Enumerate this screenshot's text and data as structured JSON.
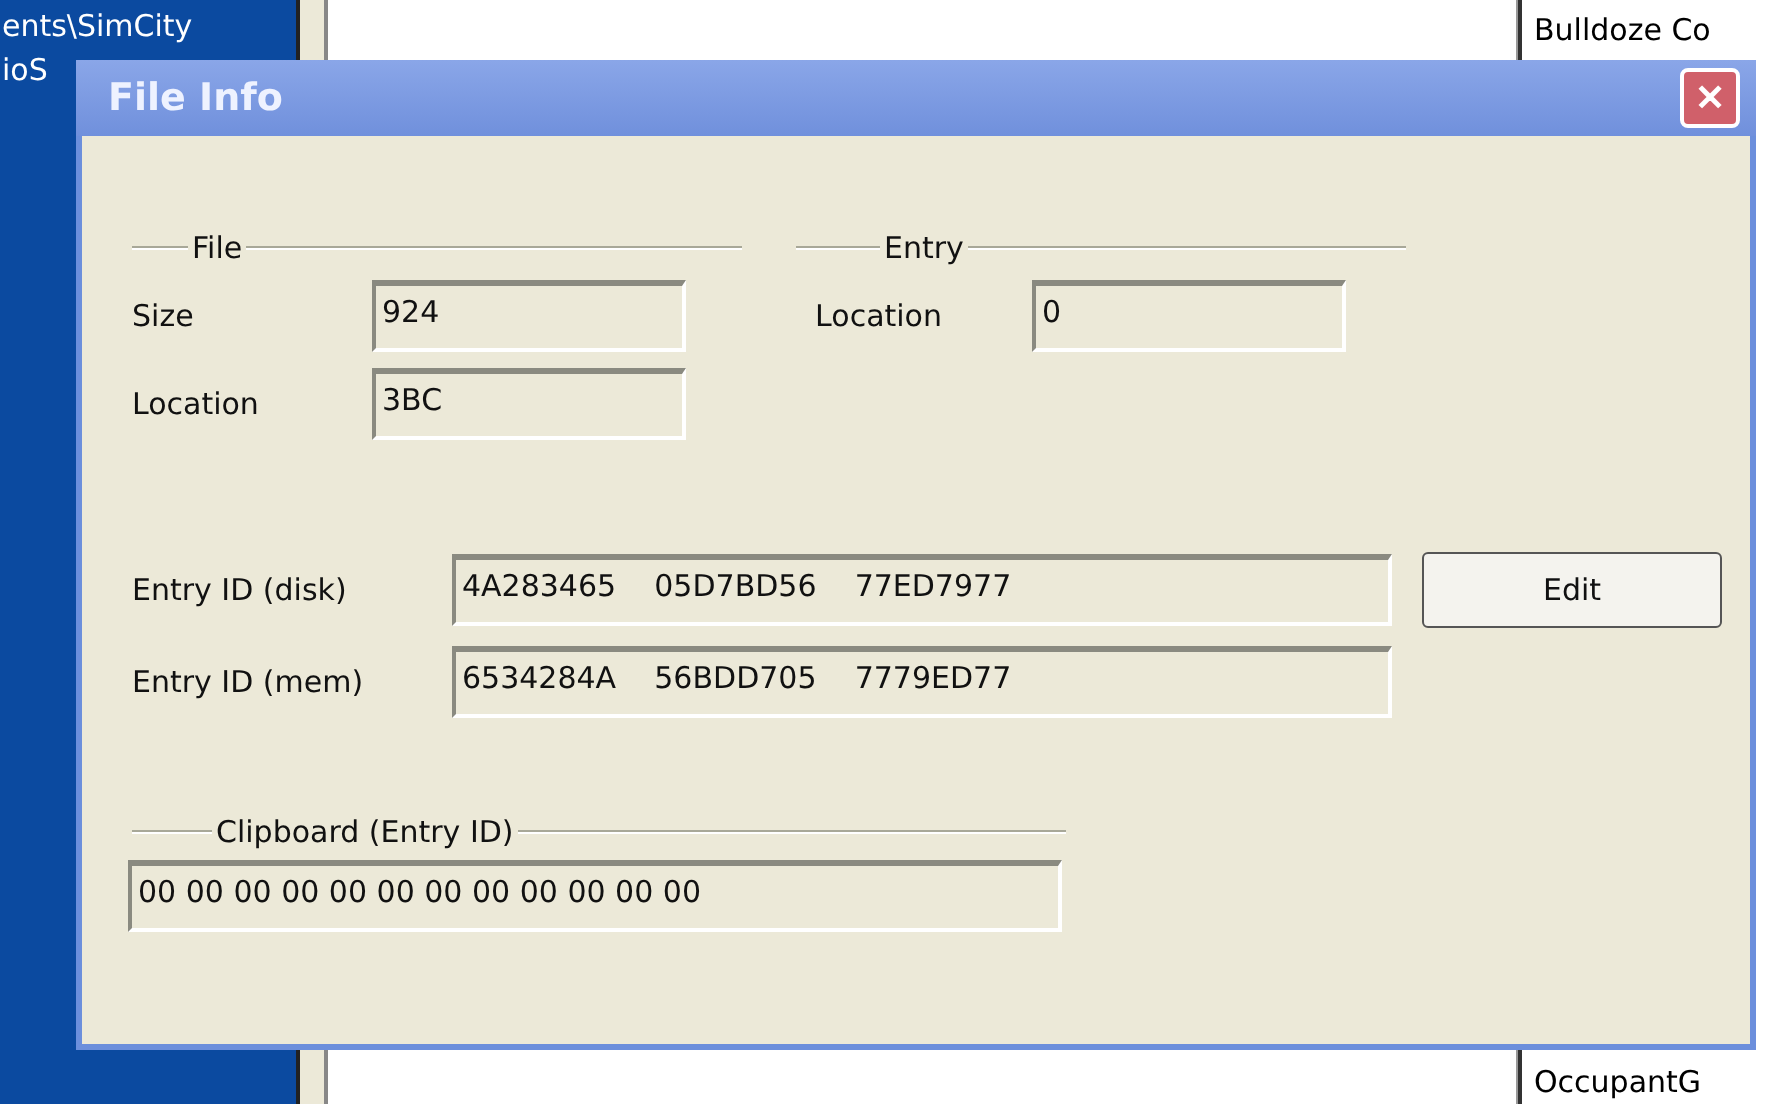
{
  "background": {
    "path_text": [
      "ents\\SimCity",
      "ioS"
    ],
    "right_list": [
      "Bulldoze Co",
      "OccupantG"
    ]
  },
  "dialog": {
    "title": "File Info",
    "close": "✕",
    "file_group": {
      "title": "File",
      "fields": [
        {
          "label": "Size",
          "value": "924"
        },
        {
          "label": "Location",
          "value": "3BC"
        }
      ]
    },
    "entry_group": {
      "title": "Entry",
      "fields": [
        {
          "label": "Location",
          "value": "0"
        }
      ]
    },
    "entry_ids": [
      {
        "label": "Entry ID (disk)",
        "value": "4A283465    05D7BD56    77ED7977"
      },
      {
        "label": "Entry ID (mem)",
        "value": "6534284A    56BDD705    7779ED77"
      }
    ],
    "edit_button": "Edit",
    "clipboard_group": {
      "title": "Clipboard (Entry ID)",
      "value": "00 00 00 00 00 00 00 00 00 00 00 00"
    }
  }
}
